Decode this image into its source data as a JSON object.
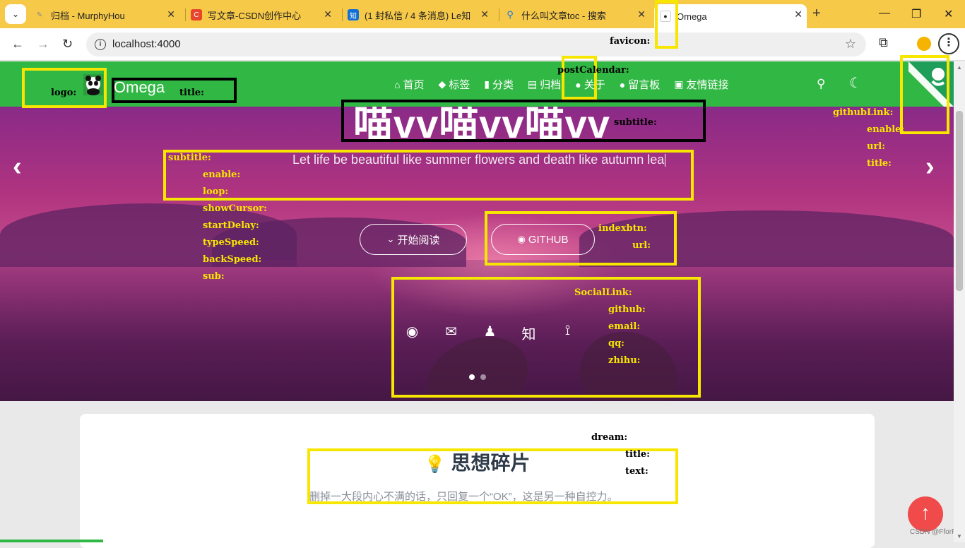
{
  "browser": {
    "tabs": [
      {
        "title": "归档 - MurphyHou",
        "icon": "feather-icon"
      },
      {
        "title": "写文章-CSDN创作中心",
        "icon": "csdn-icon",
        "icon_text": "C"
      },
      {
        "title": "(1 封私信 / 4 条消息) Le知",
        "icon": "zhihu-icon",
        "icon_text": "知"
      },
      {
        "title": "什么叫文章toc - 搜索",
        "icon": "search-icon"
      },
      {
        "title": "Omega",
        "icon": "panda-icon"
      }
    ],
    "new_tab": "+",
    "address": "localhost:4000",
    "window_controls": [
      "—",
      "❐",
      "✕"
    ]
  },
  "site": {
    "title": "Omega",
    "nav": [
      {
        "label": "首页",
        "icon": "home-icon",
        "glyph": "⌂"
      },
      {
        "label": "标签",
        "icon": "tags-icon",
        "glyph": "◆"
      },
      {
        "label": "分类",
        "icon": "bookmark-icon",
        "glyph": "▮"
      },
      {
        "label": "归档",
        "icon": "archive-icon",
        "glyph": "▤"
      },
      {
        "label": "关于",
        "icon": "user-circle-icon",
        "glyph": "●"
      },
      {
        "label": "留言板",
        "icon": "comments-icon",
        "glyph": "●"
      },
      {
        "label": "友情链接",
        "icon": "address-card-icon",
        "glyph": "▣"
      }
    ],
    "search_glyph": "🔍",
    "moon_glyph": "☾"
  },
  "hero": {
    "title": "喵vv喵vv喵vv",
    "subtitle": "Let life be beautiful like summer flowers and death like autumn lea",
    "prev": "‹",
    "next": "›",
    "buttons": [
      {
        "label": "开始阅读",
        "icon": "double-chevron-down-icon",
        "glyph": "⌄"
      },
      {
        "label": "GITHUB",
        "icon": "github-icon",
        "glyph": "◉"
      }
    ],
    "social": [
      {
        "name": "github-icon",
        "glyph": "◉"
      },
      {
        "name": "email-icon",
        "glyph": "✉"
      },
      {
        "name": "qq-icon",
        "glyph": "♟"
      },
      {
        "name": "zhihu-icon",
        "glyph": "知"
      },
      {
        "name": "rss-icon",
        "glyph": "⟟"
      }
    ],
    "slide_count": 2,
    "active_slide": 1
  },
  "dream": {
    "title": "思想碎片",
    "text": "删掉一大段内心不满的话，只回复一个“OK”，这是另一种自控力。"
  },
  "scroll_top_glyph": "↑",
  "watermark": "CSDN @FforF",
  "annotations": {
    "logo": "logo:",
    "title": "title:",
    "favicon": "favicon:",
    "postCalendar": "postCalendar:",
    "githubLink": [
      "githubLink:",
      "enable:",
      "url:",
      "title:"
    ],
    "hero_title": "subtitle:",
    "subtitle": [
      "subtitle:",
      "enable:",
      "loop:",
      "showCursor:",
      "startDelay:",
      "typeSpeed:",
      "backSpeed:",
      "sub:"
    ],
    "indexbtn": [
      "indexbtn:",
      "url:"
    ],
    "social": [
      "SocialLink:",
      "github:",
      "email:",
      "qq:",
      "zhihu:"
    ],
    "dream": [
      "dream:",
      "title:",
      "text:"
    ]
  },
  "colors": {
    "tabstrip": "#f7c948",
    "header_green": "#31b744",
    "annotation_yellow": "#f7e600",
    "scroll_top_red": "#f04a4a"
  }
}
